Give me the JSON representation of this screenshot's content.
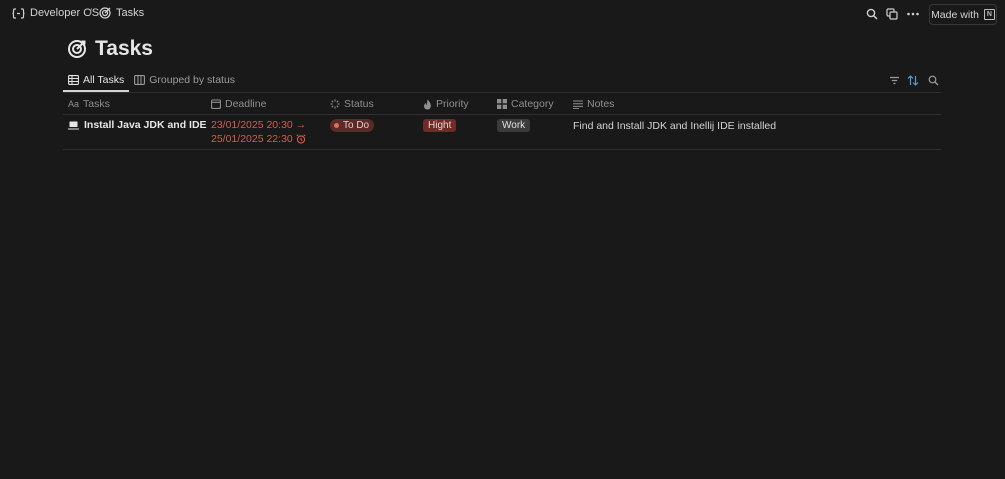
{
  "breadcrumb": {
    "parent": "Developer OS",
    "separator": "/",
    "current": "Tasks"
  },
  "topbar": {
    "made_with_label": "Made with",
    "icons": [
      "search-icon",
      "duplicate-icon",
      "more-icon",
      "notion-logo-icon"
    ]
  },
  "page": {
    "title": "Tasks",
    "title_icon": "target-icon"
  },
  "tabs": [
    {
      "label": "All Tasks",
      "icon": "table-icon",
      "active": true
    },
    {
      "label": "Grouped by status",
      "icon": "board-icon",
      "active": false
    }
  ],
  "view_tools": [
    "filter-icon",
    "sort-icon",
    "search-icon"
  ],
  "columns": [
    {
      "label": "Tasks",
      "icon": "text-icon"
    },
    {
      "label": "Deadline",
      "icon": "calendar-icon"
    },
    {
      "label": "Status",
      "icon": "status-icon"
    },
    {
      "label": "Priority",
      "icon": "fire-icon"
    },
    {
      "label": "Category",
      "icon": "grid-icon"
    },
    {
      "label": "Notes",
      "icon": "lines-icon"
    }
  ],
  "rows": [
    {
      "task": "Install Java JDK and IDE",
      "task_icon": "laptop-icon",
      "deadline_start": "23/01/2025 20:30 →",
      "deadline_end": "25/01/2025 22:30",
      "deadline_icon": "alarm-icon",
      "status": "To Do",
      "priority": "Hight",
      "category": "Work",
      "notes": "Find and Install JDK and Inellij IDE installed"
    }
  ],
  "colors": {
    "background": "#191919",
    "text": "#d4d4d4",
    "overdue": "#d65a4e",
    "accent_blue": "#529cca"
  }
}
